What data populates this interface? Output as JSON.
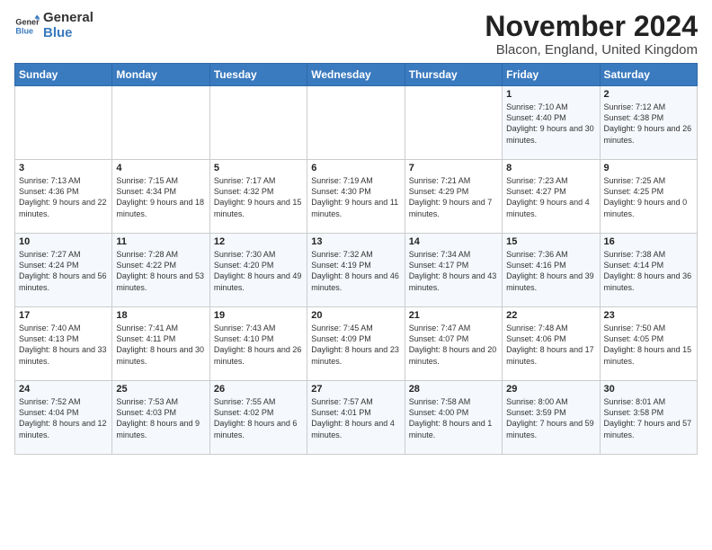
{
  "header": {
    "logo_general": "General",
    "logo_blue": "Blue",
    "title": "November 2024",
    "location": "Blacon, England, United Kingdom"
  },
  "days_of_week": [
    "Sunday",
    "Monday",
    "Tuesday",
    "Wednesday",
    "Thursday",
    "Friday",
    "Saturday"
  ],
  "weeks": [
    [
      {
        "day": "",
        "info": ""
      },
      {
        "day": "",
        "info": ""
      },
      {
        "day": "",
        "info": ""
      },
      {
        "day": "",
        "info": ""
      },
      {
        "day": "",
        "info": ""
      },
      {
        "day": "1",
        "info": "Sunrise: 7:10 AM\nSunset: 4:40 PM\nDaylight: 9 hours and 30 minutes."
      },
      {
        "day": "2",
        "info": "Sunrise: 7:12 AM\nSunset: 4:38 PM\nDaylight: 9 hours and 26 minutes."
      }
    ],
    [
      {
        "day": "3",
        "info": "Sunrise: 7:13 AM\nSunset: 4:36 PM\nDaylight: 9 hours and 22 minutes."
      },
      {
        "day": "4",
        "info": "Sunrise: 7:15 AM\nSunset: 4:34 PM\nDaylight: 9 hours and 18 minutes."
      },
      {
        "day": "5",
        "info": "Sunrise: 7:17 AM\nSunset: 4:32 PM\nDaylight: 9 hours and 15 minutes."
      },
      {
        "day": "6",
        "info": "Sunrise: 7:19 AM\nSunset: 4:30 PM\nDaylight: 9 hours and 11 minutes."
      },
      {
        "day": "7",
        "info": "Sunrise: 7:21 AM\nSunset: 4:29 PM\nDaylight: 9 hours and 7 minutes."
      },
      {
        "day": "8",
        "info": "Sunrise: 7:23 AM\nSunset: 4:27 PM\nDaylight: 9 hours and 4 minutes."
      },
      {
        "day": "9",
        "info": "Sunrise: 7:25 AM\nSunset: 4:25 PM\nDaylight: 9 hours and 0 minutes."
      }
    ],
    [
      {
        "day": "10",
        "info": "Sunrise: 7:27 AM\nSunset: 4:24 PM\nDaylight: 8 hours and 56 minutes."
      },
      {
        "day": "11",
        "info": "Sunrise: 7:28 AM\nSunset: 4:22 PM\nDaylight: 8 hours and 53 minutes."
      },
      {
        "day": "12",
        "info": "Sunrise: 7:30 AM\nSunset: 4:20 PM\nDaylight: 8 hours and 49 minutes."
      },
      {
        "day": "13",
        "info": "Sunrise: 7:32 AM\nSunset: 4:19 PM\nDaylight: 8 hours and 46 minutes."
      },
      {
        "day": "14",
        "info": "Sunrise: 7:34 AM\nSunset: 4:17 PM\nDaylight: 8 hours and 43 minutes."
      },
      {
        "day": "15",
        "info": "Sunrise: 7:36 AM\nSunset: 4:16 PM\nDaylight: 8 hours and 39 minutes."
      },
      {
        "day": "16",
        "info": "Sunrise: 7:38 AM\nSunset: 4:14 PM\nDaylight: 8 hours and 36 minutes."
      }
    ],
    [
      {
        "day": "17",
        "info": "Sunrise: 7:40 AM\nSunset: 4:13 PM\nDaylight: 8 hours and 33 minutes."
      },
      {
        "day": "18",
        "info": "Sunrise: 7:41 AM\nSunset: 4:11 PM\nDaylight: 8 hours and 30 minutes."
      },
      {
        "day": "19",
        "info": "Sunrise: 7:43 AM\nSunset: 4:10 PM\nDaylight: 8 hours and 26 minutes."
      },
      {
        "day": "20",
        "info": "Sunrise: 7:45 AM\nSunset: 4:09 PM\nDaylight: 8 hours and 23 minutes."
      },
      {
        "day": "21",
        "info": "Sunrise: 7:47 AM\nSunset: 4:07 PM\nDaylight: 8 hours and 20 minutes."
      },
      {
        "day": "22",
        "info": "Sunrise: 7:48 AM\nSunset: 4:06 PM\nDaylight: 8 hours and 17 minutes."
      },
      {
        "day": "23",
        "info": "Sunrise: 7:50 AM\nSunset: 4:05 PM\nDaylight: 8 hours and 15 minutes."
      }
    ],
    [
      {
        "day": "24",
        "info": "Sunrise: 7:52 AM\nSunset: 4:04 PM\nDaylight: 8 hours and 12 minutes."
      },
      {
        "day": "25",
        "info": "Sunrise: 7:53 AM\nSunset: 4:03 PM\nDaylight: 8 hours and 9 minutes."
      },
      {
        "day": "26",
        "info": "Sunrise: 7:55 AM\nSunset: 4:02 PM\nDaylight: 8 hours and 6 minutes."
      },
      {
        "day": "27",
        "info": "Sunrise: 7:57 AM\nSunset: 4:01 PM\nDaylight: 8 hours and 4 minutes."
      },
      {
        "day": "28",
        "info": "Sunrise: 7:58 AM\nSunset: 4:00 PM\nDaylight: 8 hours and 1 minute."
      },
      {
        "day": "29",
        "info": "Sunrise: 8:00 AM\nSunset: 3:59 PM\nDaylight: 7 hours and 59 minutes."
      },
      {
        "day": "30",
        "info": "Sunrise: 8:01 AM\nSunset: 3:58 PM\nDaylight: 7 hours and 57 minutes."
      }
    ]
  ]
}
